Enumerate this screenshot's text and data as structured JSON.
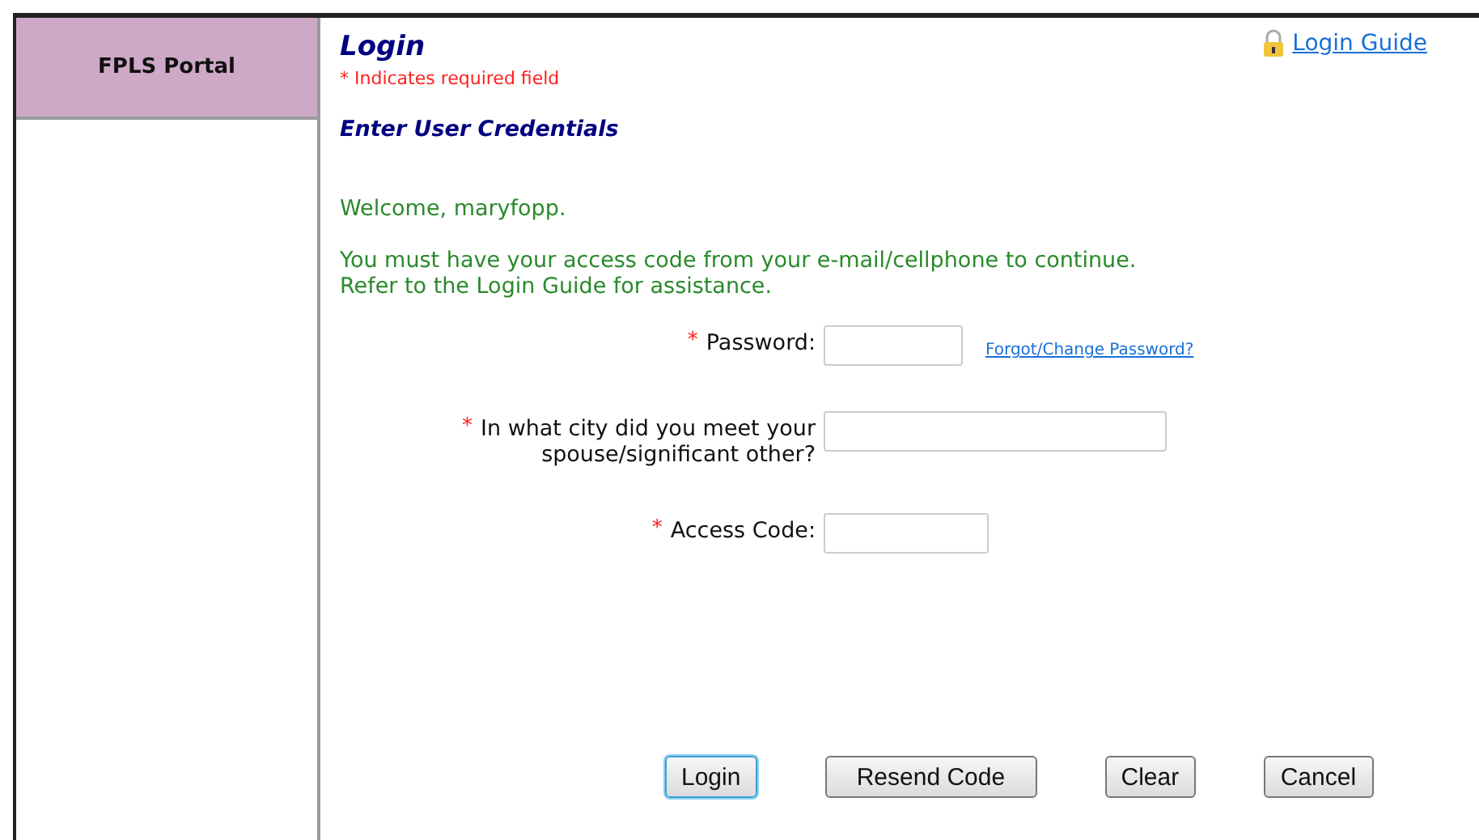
{
  "sidebar": {
    "title": "FPLS Portal"
  },
  "header": {
    "title": "Login",
    "required_note": "* Indicates required field",
    "guide_link": "Login Guide"
  },
  "section_title": "Enter User Credentials",
  "messages": [
    "Welcome, maryfopp.",
    "You must have your access code from your e-mail/cellphone to continue.\nRefer to the Login Guide for assistance."
  ],
  "fields": [
    {
      "marker": "*",
      "label": "Password:",
      "link": "Forgot/Change Password?"
    },
    {
      "marker": "*",
      "label": "In what city did you meet your\nspouse/significant other?"
    },
    {
      "marker": "*",
      "label": "Access Code:"
    }
  ],
  "buttons": [
    {
      "label": "Login",
      "focused": true
    },
    {
      "label": "Resend Code",
      "focused": false
    },
    {
      "label": "Clear",
      "focused": false
    },
    {
      "label": "Cancel",
      "focused": false
    }
  ]
}
